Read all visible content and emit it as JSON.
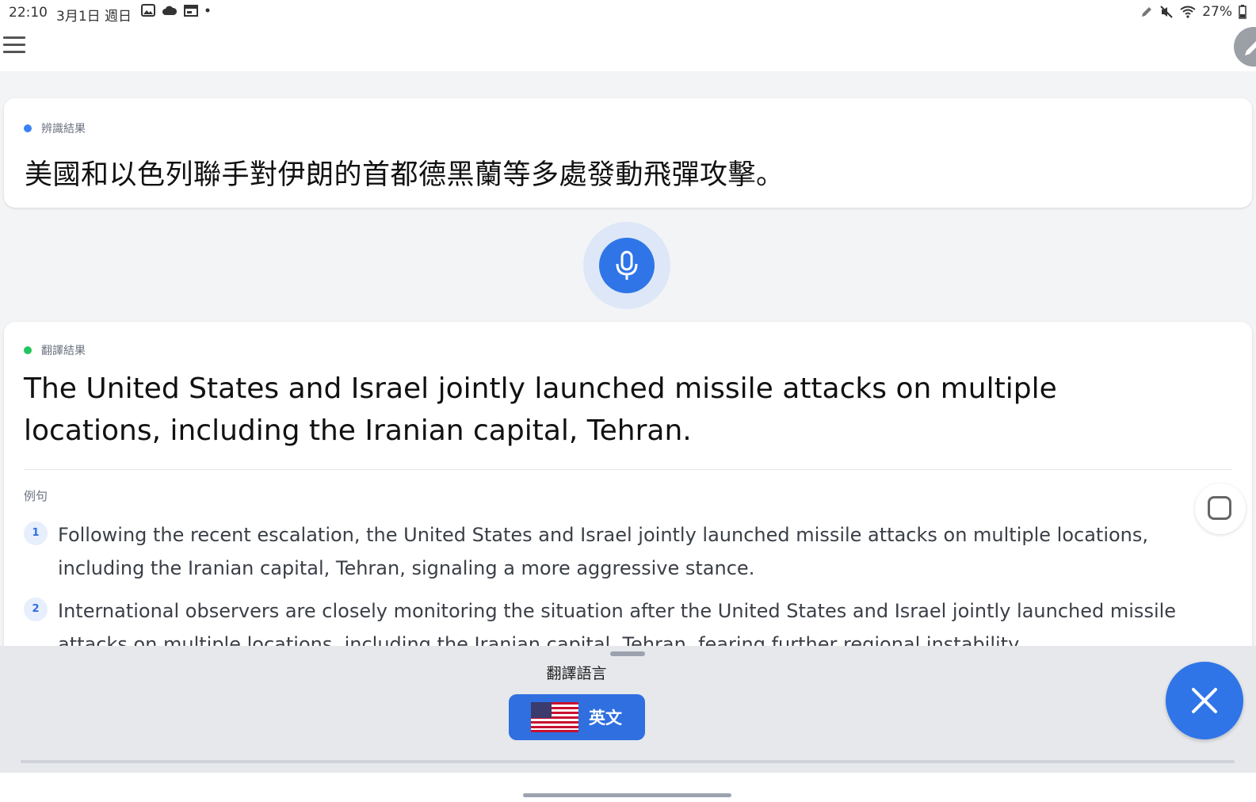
{
  "status_bar": {
    "time": "22:10",
    "date": "3月1日 週日",
    "battery": "27%",
    "icons_left": [
      "image-icon",
      "cloud-icon",
      "calendar-icon",
      "dot-icon"
    ],
    "icons_right": [
      "pen-icon",
      "mute-icon",
      "wifi-icon",
      "battery-icon"
    ]
  },
  "recognition": {
    "label": "辨識結果",
    "dot_color": "#3b82f6",
    "text": "美國和以色列聯手對伊朗的首都德黑蘭等多處發動飛彈攻擊。"
  },
  "translation": {
    "label": "翻譯結果",
    "dot_color": "#22c55e",
    "text": "The United States and Israel jointly launched missile attacks on multiple locations, including the Iranian capital, Tehran.",
    "examples_label": "例句",
    "examples": [
      {
        "num": "1",
        "text": "Following the recent escalation, the United States and Israel jointly launched missile attacks on multiple locations, including the Iranian capital, Tehran, signaling a more aggressive stance."
      },
      {
        "num": "2",
        "text": "International observers are closely monitoring the situation after the United States and Israel jointly launched missile attacks on multiple locations, including the Iranian capital, Tehran, fearing further regional instability."
      }
    ]
  },
  "bottom": {
    "language_label": "翻譯語言",
    "language_name": "英文"
  },
  "colors": {
    "accent": "#2f75e8"
  }
}
